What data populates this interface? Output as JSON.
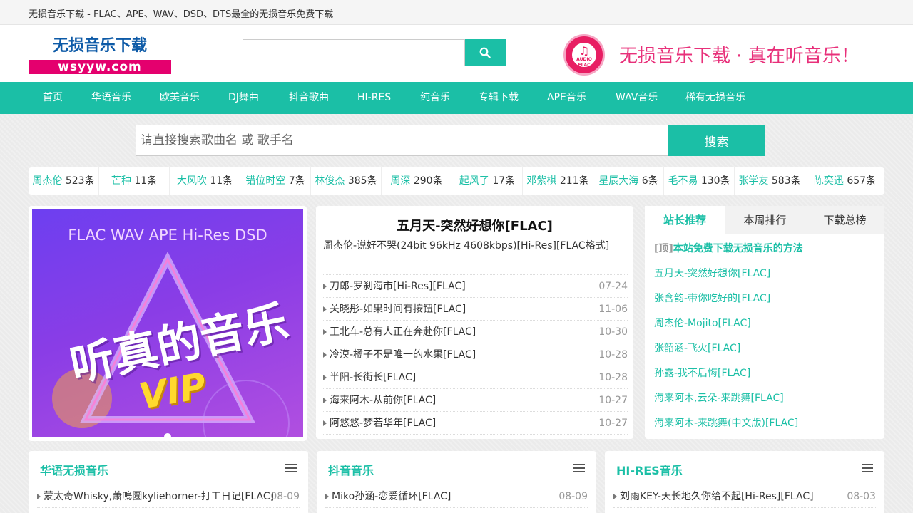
{
  "topbar": {
    "title": "无损音乐下载 - FLAC、APE、WAV、DSD、DTS最全的无损音乐免费下载"
  },
  "header": {
    "logo_cn": "无损音乐下载",
    "logo_en": "wsyyw.com",
    "search_value": "",
    "search_icon": "search-icon",
    "badge_line1": "♫",
    "badge_line2": "AUDIO FLAC",
    "slogan": "无损音乐下载 · 真在听音乐！"
  },
  "nav": [
    {
      "label": "首页"
    },
    {
      "label": "华语音乐"
    },
    {
      "label": "欧美音乐"
    },
    {
      "label": "DJ舞曲"
    },
    {
      "label": "抖音歌曲"
    },
    {
      "label": "HI-RES"
    },
    {
      "label": "纯音乐"
    },
    {
      "label": "专辑下载"
    },
    {
      "label": "APE音乐"
    },
    {
      "label": "WAV音乐"
    },
    {
      "label": "稀有无损音乐"
    }
  ],
  "search": {
    "placeholder": "请直接搜索歌曲名 或 歌手名",
    "button": "搜索"
  },
  "hot_artists": [
    {
      "name": "周杰伦",
      "count": "523条"
    },
    {
      "name": "芒种",
      "count": "11条"
    },
    {
      "name": "大风吹",
      "count": "11条"
    },
    {
      "name": "错位时空",
      "count": "7条"
    },
    {
      "name": "林俊杰",
      "count": "385条"
    },
    {
      "name": "周深",
      "count": "290条"
    },
    {
      "name": "起风了",
      "count": "17条"
    },
    {
      "name": "邓紫棋",
      "count": "211条"
    },
    {
      "name": "星辰大海",
      "count": "6条"
    },
    {
      "name": "毛不易",
      "count": "130条"
    },
    {
      "name": "张学友",
      "count": "583条"
    },
    {
      "name": "陈奕迅",
      "count": "657条"
    }
  ],
  "banner": {
    "title": "FLAC WAV APE Hi-Res DSD",
    "big": "听真的音乐",
    "vip": "VIP"
  },
  "featured": {
    "headline": "五月天-突然好想你[FLAC]",
    "sub": "周杰伦-说好不哭(24bit 96kHz 4608kbps)[Hi-Res][FLAC格式]",
    "items": [
      {
        "title": "刀郎-罗刹海市[Hi-Res][FLAC]",
        "date": "07-24"
      },
      {
        "title": "关晓彤-如果时间有按钮[FLAC]",
        "date": "11-06"
      },
      {
        "title": "王北车-总有人正在奔赴你[FLAC]",
        "date": "10-30"
      },
      {
        "title": "冷漠-橘子不是唯一的水果[FLAC]",
        "date": "10-28"
      },
      {
        "title": "半阳-长街长[FLAC]",
        "date": "10-28"
      },
      {
        "title": "海来阿木-从前你[FLAC]",
        "date": "10-27"
      },
      {
        "title": "阿悠悠-梦若华年[FLAC]",
        "date": "10-27"
      }
    ]
  },
  "sidebar": {
    "tabs": [
      {
        "label": "站长推荐"
      },
      {
        "label": "本周排行"
      },
      {
        "label": "下载总榜"
      }
    ],
    "pin": "[顶]",
    "top_item": "本站免费下载无损音乐的方法",
    "items": [
      {
        "title": "五月天-突然好想你[FLAC]"
      },
      {
        "title": "张含韵-带你吃好的[FLAC]"
      },
      {
        "title": "周杰伦-Mojito[FLAC]"
      },
      {
        "title": "张韶涵-飞火[FLAC]"
      },
      {
        "title": "孙露-我不后悔[FLAC]"
      },
      {
        "title": "海来阿木,云朵-来跳舞[FLAC]"
      },
      {
        "title": "海来阿木-来跳舞(中文版)[FLAC]"
      }
    ]
  },
  "panels": [
    {
      "title": "华语无损音乐",
      "first": {
        "title": "蒙太奇Whisky,萧鳴圜kyliehorner-打工日记[FLAC]",
        "date": "08-09"
      }
    },
    {
      "title": "抖音音乐",
      "first": {
        "title": "Miko孙涵-恋爱循环[FLAC]",
        "date": "08-09"
      }
    },
    {
      "title": "HI-RES音乐",
      "first": {
        "title": "刘雨KEY-天长地久你给不起[Hi-Res][FLAC]",
        "date": "08-03"
      }
    }
  ],
  "colors": {
    "accent": "#1bbfa6",
    "brand_pink": "#e4006e",
    "logo_blue": "#0d5aa7"
  }
}
